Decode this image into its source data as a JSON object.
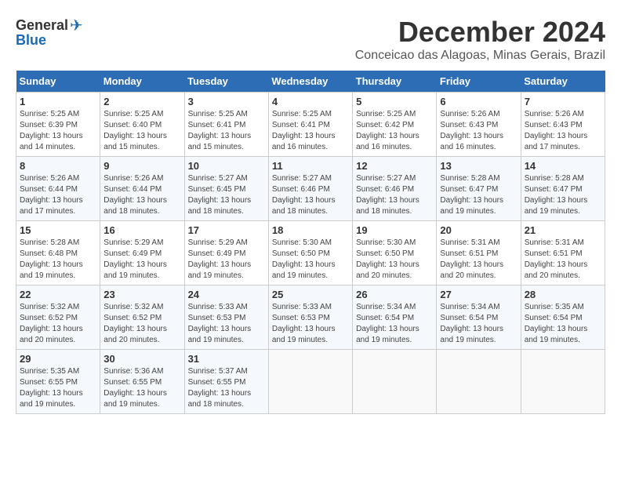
{
  "header": {
    "logo_general": "General",
    "logo_blue": "Blue",
    "month_title": "December 2024",
    "subtitle": "Conceicao das Alagoas, Minas Gerais, Brazil"
  },
  "weekdays": [
    "Sunday",
    "Monday",
    "Tuesday",
    "Wednesday",
    "Thursday",
    "Friday",
    "Saturday"
  ],
  "weeks": [
    [
      {
        "day": "1",
        "sunrise": "5:25 AM",
        "sunset": "6:39 PM",
        "daylight": "13 hours and 14 minutes."
      },
      {
        "day": "2",
        "sunrise": "5:25 AM",
        "sunset": "6:40 PM",
        "daylight": "13 hours and 15 minutes."
      },
      {
        "day": "3",
        "sunrise": "5:25 AM",
        "sunset": "6:41 PM",
        "daylight": "13 hours and 15 minutes."
      },
      {
        "day": "4",
        "sunrise": "5:25 AM",
        "sunset": "6:41 PM",
        "daylight": "13 hours and 16 minutes."
      },
      {
        "day": "5",
        "sunrise": "5:25 AM",
        "sunset": "6:42 PM",
        "daylight": "13 hours and 16 minutes."
      },
      {
        "day": "6",
        "sunrise": "5:26 AM",
        "sunset": "6:43 PM",
        "daylight": "13 hours and 16 minutes."
      },
      {
        "day": "7",
        "sunrise": "5:26 AM",
        "sunset": "6:43 PM",
        "daylight": "13 hours and 17 minutes."
      }
    ],
    [
      {
        "day": "8",
        "sunrise": "5:26 AM",
        "sunset": "6:44 PM",
        "daylight": "13 hours and 17 minutes."
      },
      {
        "day": "9",
        "sunrise": "5:26 AM",
        "sunset": "6:44 PM",
        "daylight": "13 hours and 18 minutes."
      },
      {
        "day": "10",
        "sunrise": "5:27 AM",
        "sunset": "6:45 PM",
        "daylight": "13 hours and 18 minutes."
      },
      {
        "day": "11",
        "sunrise": "5:27 AM",
        "sunset": "6:46 PM",
        "daylight": "13 hours and 18 minutes."
      },
      {
        "day": "12",
        "sunrise": "5:27 AM",
        "sunset": "6:46 PM",
        "daylight": "13 hours and 18 minutes."
      },
      {
        "day": "13",
        "sunrise": "5:28 AM",
        "sunset": "6:47 PM",
        "daylight": "13 hours and 19 minutes."
      },
      {
        "day": "14",
        "sunrise": "5:28 AM",
        "sunset": "6:47 PM",
        "daylight": "13 hours and 19 minutes."
      }
    ],
    [
      {
        "day": "15",
        "sunrise": "5:28 AM",
        "sunset": "6:48 PM",
        "daylight": "13 hours and 19 minutes."
      },
      {
        "day": "16",
        "sunrise": "5:29 AM",
        "sunset": "6:49 PM",
        "daylight": "13 hours and 19 minutes."
      },
      {
        "day": "17",
        "sunrise": "5:29 AM",
        "sunset": "6:49 PM",
        "daylight": "13 hours and 19 minutes."
      },
      {
        "day": "18",
        "sunrise": "5:30 AM",
        "sunset": "6:50 PM",
        "daylight": "13 hours and 19 minutes."
      },
      {
        "day": "19",
        "sunrise": "5:30 AM",
        "sunset": "6:50 PM",
        "daylight": "13 hours and 20 minutes."
      },
      {
        "day": "20",
        "sunrise": "5:31 AM",
        "sunset": "6:51 PM",
        "daylight": "13 hours and 20 minutes."
      },
      {
        "day": "21",
        "sunrise": "5:31 AM",
        "sunset": "6:51 PM",
        "daylight": "13 hours and 20 minutes."
      }
    ],
    [
      {
        "day": "22",
        "sunrise": "5:32 AM",
        "sunset": "6:52 PM",
        "daylight": "13 hours and 20 minutes."
      },
      {
        "day": "23",
        "sunrise": "5:32 AM",
        "sunset": "6:52 PM",
        "daylight": "13 hours and 20 minutes."
      },
      {
        "day": "24",
        "sunrise": "5:33 AM",
        "sunset": "6:53 PM",
        "daylight": "13 hours and 19 minutes."
      },
      {
        "day": "25",
        "sunrise": "5:33 AM",
        "sunset": "6:53 PM",
        "daylight": "13 hours and 19 minutes."
      },
      {
        "day": "26",
        "sunrise": "5:34 AM",
        "sunset": "6:54 PM",
        "daylight": "13 hours and 19 minutes."
      },
      {
        "day": "27",
        "sunrise": "5:34 AM",
        "sunset": "6:54 PM",
        "daylight": "13 hours and 19 minutes."
      },
      {
        "day": "28",
        "sunrise": "5:35 AM",
        "sunset": "6:54 PM",
        "daylight": "13 hours and 19 minutes."
      }
    ],
    [
      {
        "day": "29",
        "sunrise": "5:35 AM",
        "sunset": "6:55 PM",
        "daylight": "13 hours and 19 minutes."
      },
      {
        "day": "30",
        "sunrise": "5:36 AM",
        "sunset": "6:55 PM",
        "daylight": "13 hours and 19 minutes."
      },
      {
        "day": "31",
        "sunrise": "5:37 AM",
        "sunset": "6:55 PM",
        "daylight": "13 hours and 18 minutes."
      },
      null,
      null,
      null,
      null
    ]
  ],
  "labels": {
    "sunrise": "Sunrise:",
    "sunset": "Sunset:",
    "daylight": "Daylight:"
  }
}
